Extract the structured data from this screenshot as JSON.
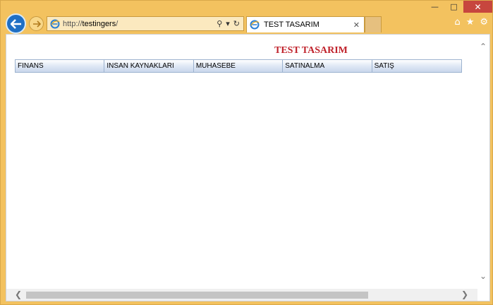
{
  "browser": {
    "url_prefix": "http://",
    "url_host": "testingers",
    "url_suffix": "/",
    "tab_title": "TEST TASARIM",
    "icons": {
      "back": "back-arrow-icon",
      "forward": "forward-arrow-icon",
      "search": "search-icon",
      "refresh": "refresh-icon",
      "home": "home-icon",
      "favorites": "star-icon",
      "settings": "gear-icon"
    }
  },
  "page": {
    "title": "TEST TASARIM",
    "title_color": "#c0232c",
    "menu": [
      "FINANS",
      "INSAN KAYNAKLARI",
      "MUHASEBE",
      "SATINALMA",
      "SATIŞ"
    ]
  },
  "colors": {
    "frame": "#f3c25f",
    "back_button": "#1f6fc4",
    "close_button": "#c7463e"
  }
}
